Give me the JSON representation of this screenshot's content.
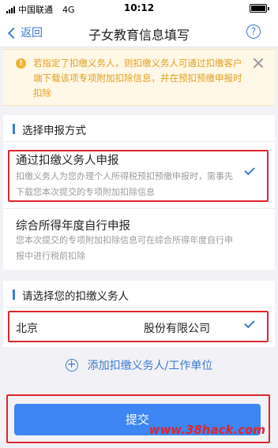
{
  "status_bar": {
    "carrier": "中国联通",
    "network": "4G",
    "time": "10:12"
  },
  "nav": {
    "back_label": "返回",
    "title": "子女教育信息填写",
    "help_symbol": "?"
  },
  "notice": {
    "icon_symbol": "!",
    "text": "若指定了扣缴义务人，则扣缴义务人可通过扣缴客户端下载该项专项附加扣除信息，并在预扣预缴申报时扣除"
  },
  "method_section": {
    "title": "选择申报方式",
    "options": [
      {
        "title": "通过扣缴义务人申报",
        "desc": "扣缴义务人为您办理个人所得税预扣预缴申报时，需事先下载您本次提交的专项附加扣除信息",
        "selected": true
      },
      {
        "title": "综合所得年度自行申报",
        "desc": "您本次提交的专项附加扣除信息可在综合所得年度自行申报中进行税前扣除",
        "selected": false
      }
    ]
  },
  "withholder_section": {
    "title": "请选择您的扣缴义务人",
    "name_prefix": "北京",
    "name_suffix": "股份有限公司",
    "selected": true
  },
  "add_withholder": {
    "icon_symbol": "+",
    "label": "添加扣缴义务人/工作单位"
  },
  "submit": {
    "label": "提交"
  },
  "watermark": "www.38hack.com",
  "colors": {
    "accent": "#3a7bd5",
    "submit": "#3d86f3",
    "highlight_frame": "#e0252b",
    "notice_text": "#e2a024",
    "notice_bg": "#fff8e6"
  }
}
